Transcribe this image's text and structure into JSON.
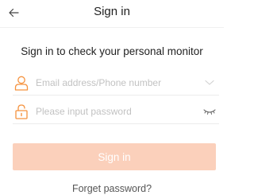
{
  "header": {
    "title": "Sign in",
    "back_icon": "back-arrow-icon"
  },
  "subtitle": "Sign in to check your personal monitor",
  "form": {
    "email": {
      "placeholder": "Email address/Phone number",
      "value": "",
      "icon": "user-icon",
      "dropdown_icon": "chevron-down-icon"
    },
    "password": {
      "placeholder": "Please input password",
      "value": "",
      "icon": "lock-icon",
      "visibility_icon": "eye-closed-icon"
    }
  },
  "signin_button": {
    "label": "Sign in",
    "color": "#fbd0bb"
  },
  "forget_password": "Forget password?",
  "colors": {
    "accent": "#f5923e",
    "button_disabled": "#fbd0bb",
    "placeholder": "#c2c2c2"
  }
}
